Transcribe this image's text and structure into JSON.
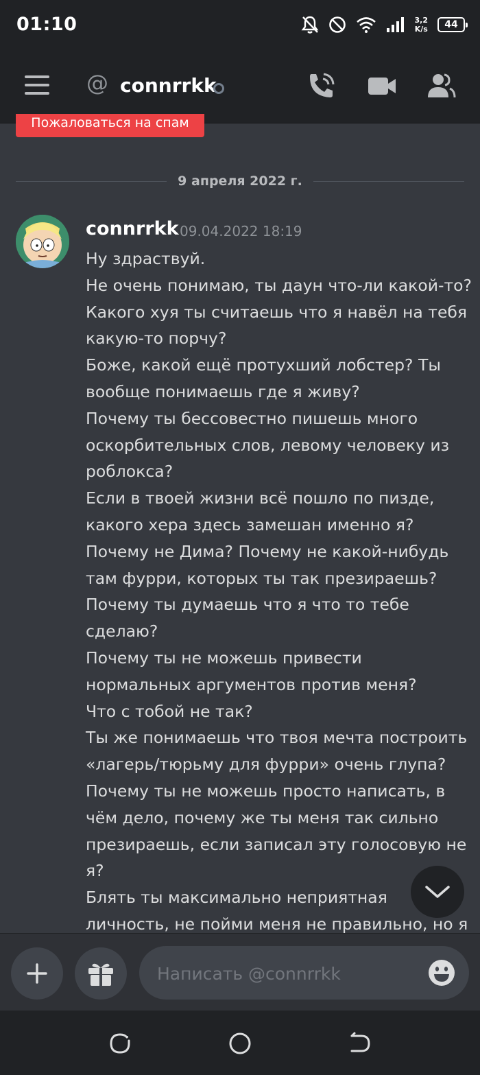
{
  "status_bar": {
    "time": "01:10",
    "net_speed_value": "3,2",
    "net_speed_unit": "K/s",
    "battery": "44",
    "icons": [
      "bell-off-icon",
      "do-not-disturb-icon",
      "wifi-icon",
      "signal-icon"
    ]
  },
  "header": {
    "at_symbol": "@",
    "title": "connrrkk",
    "status": "offline",
    "icons": [
      "menu-icon",
      "call-icon",
      "video-icon",
      "members-icon"
    ]
  },
  "report_spam_label": "Пожаловаться на спам",
  "date_divider": "9 апреля 2022 г.",
  "message": {
    "author": "connrrkk",
    "timestamp": "09.04.2022 18:19",
    "lines": [
      "Ну здраствуй.",
      "Не очень понимаю, ты даун что-ли какой-то?",
      "Какого хуя ты считаешь что я навёл на тебя",
      "какую-то порчу?",
      "Боже, какой ещё протухший лобстер? Ты",
      "вообще понимаешь где я живу?",
      "Почему ты бессовестно пишешь много",
      "оскорбительных слов, левому человеку из",
      "роблокса?",
      "Если в твоей жизни всё пошло по пизде,",
      "какого хера здесь замешан именно я?",
      "Почему не Дима? Почему не какой-нибудь",
      "там фурри, которых ты так презираешь?",
      "Почему ты думаешь что я что то тебе",
      "сделаю?",
      "Почему ты не можешь привести",
      "нормальных аргументов против меня?",
      "Что с тобой не так?",
      "Ты же понимаешь что твоя мечта построить",
      "«лагерь/тюрьму для фурри» очень глупа?",
      "Почему ты не можешь просто написать, в",
      "чём дело, почему же ты меня так сильно",
      "презираешь, если записал эту голосовую не",
      "я?",
      "Блять ты максимально неприятная",
      "личность, не пойми меня не правильно, но я"
    ]
  },
  "composer": {
    "placeholder": "Написать @connrrkk",
    "icons": [
      "plus-icon",
      "gift-icon",
      "emoji-icon"
    ]
  },
  "navbar": {
    "icons": [
      "recents-icon",
      "home-icon",
      "back-icon"
    ]
  },
  "colors": {
    "background": "#36393f",
    "header": "#202225",
    "danger": "#ed4245",
    "text": "#dcddde"
  }
}
